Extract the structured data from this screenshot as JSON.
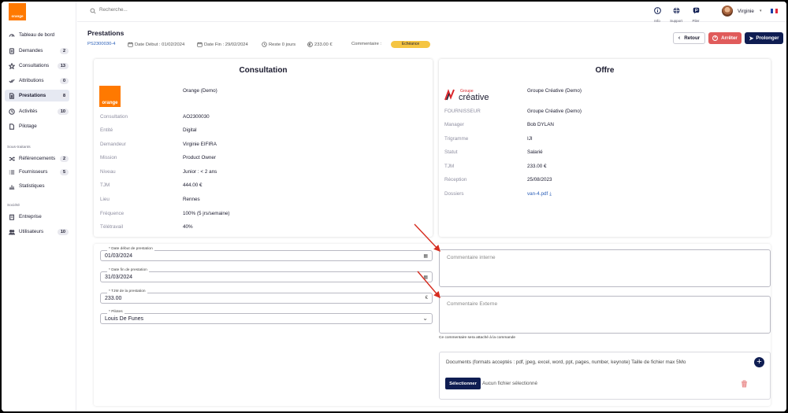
{
  "brand": {
    "logo_text": "orange",
    "accent": "#ff7900",
    "navy": "#0f1d52",
    "danger": "#e05b5b",
    "badge": "#f5c542",
    "link": "#2a5fb8"
  },
  "sidebar": {
    "items": [
      {
        "label": "Tableau de bord",
        "icon": "dashboard-icon",
        "count": ""
      },
      {
        "label": "Demandes",
        "icon": "document-icon",
        "count": "2"
      },
      {
        "label": "Consultations",
        "icon": "star-icon",
        "count": "13"
      },
      {
        "label": "Attributions",
        "icon": "check-icon",
        "count": "0"
      },
      {
        "label": "Prestations",
        "icon": "file-user-icon",
        "count": "8"
      },
      {
        "label": "Activités",
        "icon": "clock-icon",
        "count": "10"
      },
      {
        "label": "Pilotage",
        "icon": "page-icon",
        "count": ""
      }
    ],
    "section_subcontractors": "Sous-traitants",
    "sub_items": [
      {
        "label": "Référencements",
        "icon": "shuffle-icon",
        "count": "2"
      },
      {
        "label": "Fournisseurs",
        "icon": "list-icon",
        "count": "5"
      },
      {
        "label": "Statistiques",
        "icon": "chart-icon",
        "count": ""
      }
    ],
    "section_company": "Société",
    "company_items": [
      {
        "label": "Entreprise",
        "icon": "building-icon",
        "count": ""
      },
      {
        "label": "Utilisateurs",
        "icon": "users-icon",
        "count": "10"
      }
    ]
  },
  "topbar": {
    "search_placeholder": "Recherche...",
    "info_label": "Info",
    "support_label": "Support",
    "piler_label": "Piler",
    "user_name": "Virginie"
  },
  "header": {
    "title": "Prestations",
    "reference": "PS2300030-4",
    "date_start": "Date Début : 01/02/2024",
    "date_end": "Date Fin : 29/02/2024",
    "remaining": "Reste 0 jours",
    "amount": "233.00 €",
    "comment_label": "Commentaire :",
    "badge": "Echéance",
    "back_label": "Retour",
    "stop_label": "Arrêter",
    "extend_label": "Prolonger"
  },
  "consultation": {
    "title": "Consultation",
    "logo_text": "orange",
    "org_name": "Orange (Demo)",
    "fields": [
      {
        "label": "Consultation",
        "value": "AO2300030"
      },
      {
        "label": "Entité",
        "value": "Digital"
      },
      {
        "label": "Demandeur",
        "value": "Virginie EIFIRA"
      },
      {
        "label": "Mission",
        "value": "Product Owner"
      },
      {
        "label": "Niveau",
        "value": "Junior : < 2 ans"
      },
      {
        "label": "TJM",
        "value": "444.00 €"
      },
      {
        "label": "Lieu",
        "value": "Rennes"
      },
      {
        "label": "Fréquence",
        "value": "100% (5 jrs/semaine)"
      },
      {
        "label": "Télétravail",
        "value": "40%"
      }
    ]
  },
  "offre": {
    "title": "Offre",
    "logo_small": "Groupe",
    "logo_big": "créative",
    "org_name": "Groupe Créative (Demo)",
    "fields": [
      {
        "label": "FOURNISSEUR",
        "value": "Groupe Créative (Demo)"
      },
      {
        "label": "Manager",
        "value": "Bob DYLAN"
      },
      {
        "label": "Trigramme",
        "value": "IJI"
      },
      {
        "label": "Statut",
        "value": "Salarié"
      },
      {
        "label": "TJM",
        "value": "233.00 €"
      },
      {
        "label": "Réception",
        "value": "25/08/2023"
      },
      {
        "label": "Dossiers",
        "value": "van-4.pdf"
      }
    ]
  },
  "form": {
    "start_label": "* Date début de prestation",
    "start_value": "01/03/2024",
    "end_label": "* Date fin de prestation",
    "end_value": "31/03/2024",
    "tjm_label": "* TJM de la prestation",
    "tjm_value": "233.00",
    "tjm_unit": "€",
    "pilots_label": "* Pilotes",
    "pilots_value": "Louis De Funes",
    "internal_comment_placeholder": "Commentaire interne",
    "external_comment_placeholder": "Commentaire Externe",
    "external_note": "Ce commentaire sera attaché à la commande",
    "docs_title": "Documents (formats acceptés : pdf, jpeg, excel, word, ppt, pages, number, keynote) Taille de fichier max 5Mo",
    "select_label": "Sélectionner",
    "no_file": "Aucun fichier sélectionné",
    "add_symbol": "+"
  }
}
